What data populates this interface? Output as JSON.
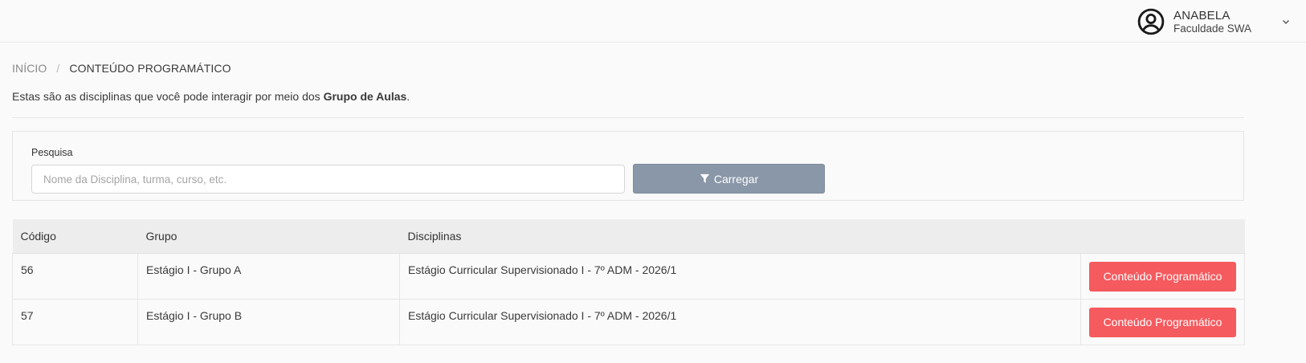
{
  "header": {
    "user_name": "ANABELA",
    "user_org": "Faculdade SWA",
    "avatar_icon": "user-circle-icon",
    "dropdown_icon": "chevron-down-icon"
  },
  "breadcrumb": {
    "home": "INÍCIO",
    "separator": "/",
    "current": "CONTEÚDO PROGRAMÁTICO"
  },
  "intro": {
    "text_before": "Estas são as disciplinas que você pode interagir por meio dos ",
    "text_bold": "Grupo de Aulas",
    "text_after": "."
  },
  "search": {
    "label": "Pesquisa",
    "value": "",
    "placeholder": "Nome da Disciplina, turma, curso, etc.",
    "button_label": "Carregar",
    "button_icon": "filter-icon"
  },
  "table": {
    "columns": [
      "Código",
      "Grupo",
      "Disciplinas",
      ""
    ],
    "rows": [
      {
        "codigo": "56",
        "grupo": "Estágio I - Grupo A",
        "disciplinas": "Estágio Curricular Supervisionado I - 7º ADM - 2026/1",
        "action": "Conteúdo Programático"
      },
      {
        "codigo": "57",
        "grupo": "Estágio I - Grupo B",
        "disciplinas": "Estágio Curricular Supervisionado I - 7º ADM - 2026/1",
        "action": "Conteúdo Programático"
      }
    ]
  },
  "colors": {
    "action_button": "#f55a5e",
    "load_button": "#8a97a8",
    "table_header_bg": "#ededed"
  }
}
